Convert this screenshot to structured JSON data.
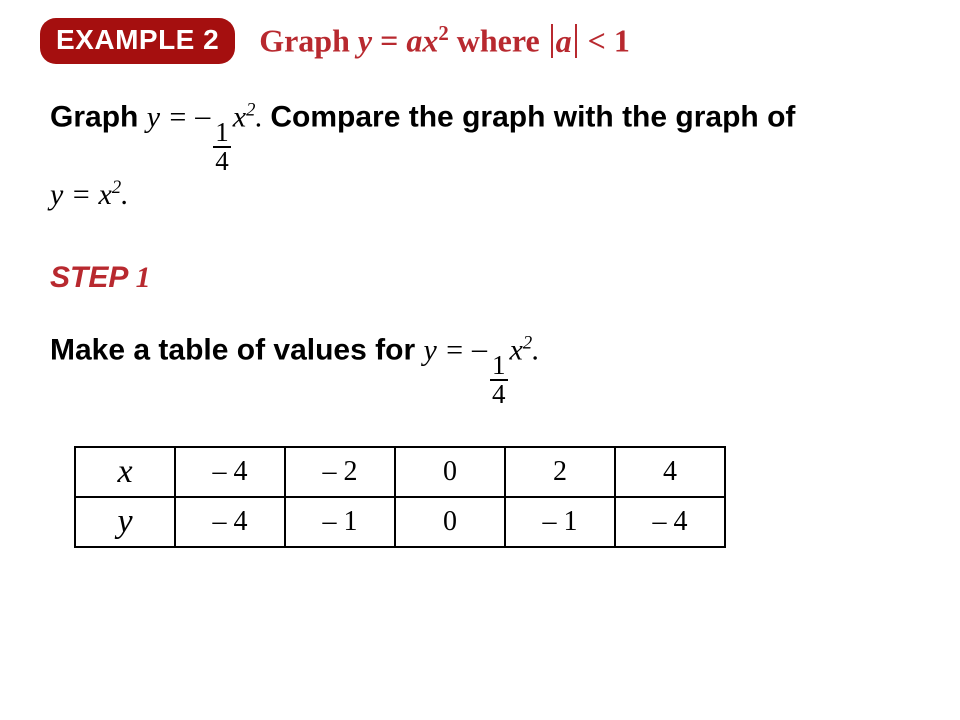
{
  "badge": {
    "label": "EXAMPLE 2"
  },
  "title": {
    "prefix": "Graph ",
    "var_y": "y",
    "eq": " = ",
    "var_a": "a",
    "var_x": "x",
    "exp": "2",
    "where": " where ",
    "lt": " < 1"
  },
  "prompt": {
    "graph_word": "Graph ",
    "y_eq": "y =",
    "minus": "–",
    "frac_num": "1",
    "frac_den": "4",
    "x": "x",
    "exp": "2",
    "period": ".",
    "compare": " Compare the graph with the graph of",
    "y_eq_x2": "y = x",
    "exp2": "2",
    "period2": "."
  },
  "step": {
    "label": "STEP",
    "num": "1"
  },
  "make": {
    "text": "Make a table of values for ",
    "y_eq": "y =",
    "minus": "–",
    "frac_num": "1",
    "frac_den": "4",
    "x": "x",
    "exp": "2",
    "period": "."
  },
  "table": {
    "row_x_label": "x",
    "row_y_label": "y",
    "x_vals": [
      "– 4",
      "– 2",
      "0",
      "2",
      "4"
    ],
    "y_vals": [
      "– 4",
      "– 1",
      "0",
      "– 1",
      "– 4"
    ]
  },
  "chart_data": {
    "type": "table",
    "title": "Table of values for y = -(1/4)x^2",
    "columns": [
      "x",
      "y"
    ],
    "rows": [
      {
        "x": -4,
        "y": -4
      },
      {
        "x": -2,
        "y": -1
      },
      {
        "x": 0,
        "y": 0
      },
      {
        "x": 2,
        "y": -1
      },
      {
        "x": 4,
        "y": -4
      }
    ]
  }
}
